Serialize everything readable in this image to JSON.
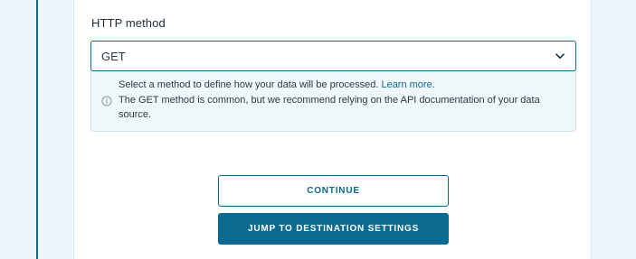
{
  "http_method": {
    "label": "HTTP method",
    "selected": "GET",
    "help": {
      "line1_text": "Select a method to define how your data will be processed. ",
      "learn_more": "Learn more.",
      "line2_text": "The GET method is common, but we recommend relying on the API documentation of your data source."
    }
  },
  "actions": {
    "continue_label": "CONTINUE",
    "jump_label": "JUMP TO DESTINATION SETTINGS"
  },
  "colors": {
    "accent": "#0b6a8f",
    "help_bg": "#f0f8fc",
    "page_bg": "#eef6fb"
  },
  "icons": {
    "select_chevron": "chevron-down-icon",
    "help_info": "info-icon"
  }
}
